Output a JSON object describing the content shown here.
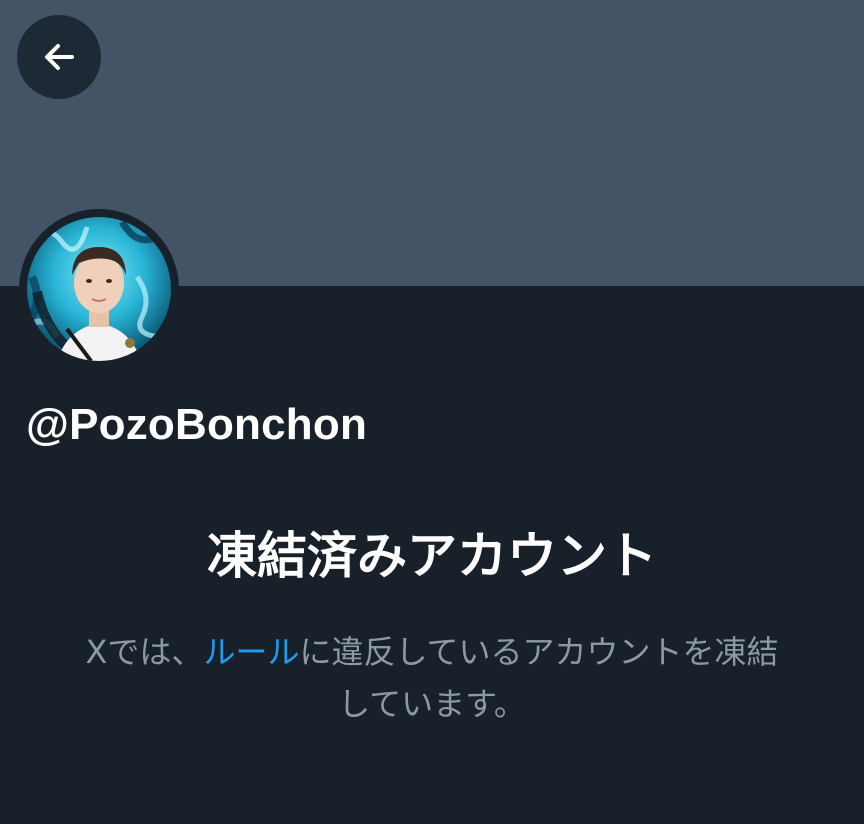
{
  "header": {
    "back_icon": "arrow-left-icon",
    "banner_color": "#425466"
  },
  "profile": {
    "handle": "@PozoBonchon",
    "avatar_alt": "profile photo"
  },
  "notice": {
    "title": "凍結済みアカウント",
    "description_prefix": "Xでは、",
    "rules_link": "ルール",
    "description_line1_suffix": "に違反しているアカウントを凍結",
    "description_line2": "しています。"
  },
  "colors": {
    "background": "#18202a",
    "text_primary": "#ffffff",
    "text_secondary": "#8b98a5",
    "link": "#1d9bf0"
  }
}
